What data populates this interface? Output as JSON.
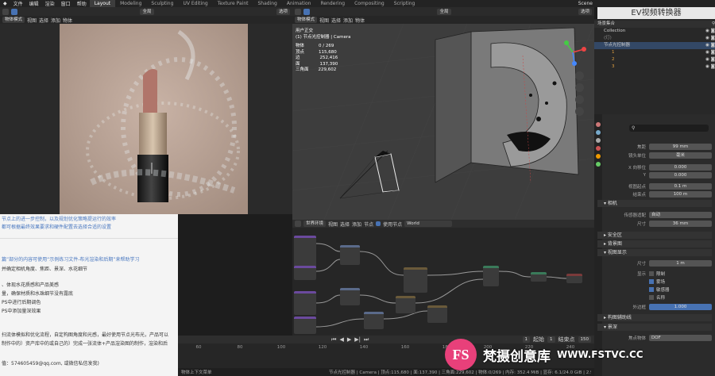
{
  "topbar": {
    "menus": [
      "文件",
      "编辑",
      "渲染",
      "窗口",
      "帮助"
    ],
    "tabs": [
      "Layout",
      "Modeling",
      "Sculpting",
      "UV Editing",
      "Texture Paint",
      "Shading",
      "Animation",
      "Rendering",
      "Compositing",
      "Scripting"
    ],
    "active_tab": "Layout",
    "scene_label": "Scene"
  },
  "left_header": {
    "mode": "物体模式",
    "menus": [
      "视图",
      "选择",
      "添加",
      "物体"
    ],
    "transform": "全局",
    "select_label": "选项"
  },
  "viewport": {
    "mode": "物体模式",
    "menus": [
      "视图",
      "选择",
      "添加",
      "物体"
    ],
    "transform": "全局",
    "options": "选项",
    "view_name": "用户正交",
    "collection_info": "(1) 节点光控制器 | Camera",
    "stats": [
      {
        "label": "物体",
        "value": "0 / 269"
      },
      {
        "label": "顶点",
        "value": "115,680"
      },
      {
        "label": "边",
        "value": "252,416"
      },
      {
        "label": "面",
        "value": "137,390"
      },
      {
        "label": "三角面",
        "value": "229,602"
      }
    ]
  },
  "doc": {
    "lines_top": [
      "节点上的进一步控制，以及规划优化策略提运行的效率",
      "都可根据最终效果要求和硬件配置去选择合适的设置"
    ],
    "lines_bottom": [
      "篇”部分的内容可使用“示例练习文件-布光渲染和后期”来帮助学习",
      "并确定相机角度、焦距、景深、水花细节",
      "、体现水花质感和产品美感",
      "量，确保材质和水珠细节没有露底",
      "PS中进行后期调色",
      "PS中添加量深效果",
      "扫流体模拟和优化流程，自定构图角度和光感，最好使用节点光布光，产品可以",
      "制作中的）资产库中的或自己的）完成一张流体+产品渲染图的制作，渲染和后",
      "值：574605459@qq.com, 或微信私信发我)"
    ]
  },
  "node_editor": {
    "header_items": [
      "世界环境",
      "视图",
      "选择",
      "添加",
      "节点",
      "使用节点"
    ],
    "world_name": "World"
  },
  "timeline": {
    "ticks": [
      "60",
      "80",
      "100",
      "120",
      "140",
      "160",
      "180",
      "200",
      "220",
      "240"
    ],
    "frame": "1",
    "start_label": "起始",
    "start": "1",
    "end_label": "结束点",
    "end": "150"
  },
  "status_bar": {
    "left": "物体上下文菜单",
    "right": "节点光控制器 | Camera | 顶点:115,680 | 面:137,390 | 三角面:229,602 | 物体:0/269 | 内存: 352.4 MiB | 显存: 6.1/24.0 GiB | 2.92.0"
  },
  "outliner": {
    "title": "场景集合",
    "rows": [
      "Collection",
      "(灯)",
      "节点光控制器",
      "1",
      "2",
      "3"
    ]
  },
  "properties": {
    "search_placeholder": "",
    "rows": [
      {
        "label": "焦距",
        "value": "99 mm"
      },
      {
        "label": "镜头单位",
        "value": "毫米"
      },
      {
        "label": "X 向移位",
        "value": "0.000"
      },
      {
        "label": "Y",
        "value": "0.000"
      },
      {
        "label": "视图起点",
        "value": "0.1 m"
      },
      {
        "label": "结束点",
        "value": "100 m"
      }
    ],
    "camera_section": "相机",
    "sensor_label": "传感器适配",
    "sensor_value": "自动",
    "size_label": "尺寸",
    "size_value": "36 mm",
    "safe_areas": "安全区",
    "background_images": "背景图",
    "viewport_display": "视图显示",
    "vd_size_label": "尺寸",
    "vd_size_value": "1 m",
    "show_label": "显示",
    "checks": [
      "限制",
      "雾场",
      "敏感器",
      "名称"
    ],
    "passepartout_label": "外边框",
    "passepartout_value": "1.000",
    "composition_guides": "构图辅助线",
    "dof_section": "景深",
    "focus_label": "焦点物体",
    "focus_value": "DOF"
  },
  "watermarks": {
    "top": "EV视频转换器",
    "bottom_brand": "梵摄创意库",
    "bottom_url": "WWW.FSTVC.CC",
    "logo_text": "FS"
  }
}
